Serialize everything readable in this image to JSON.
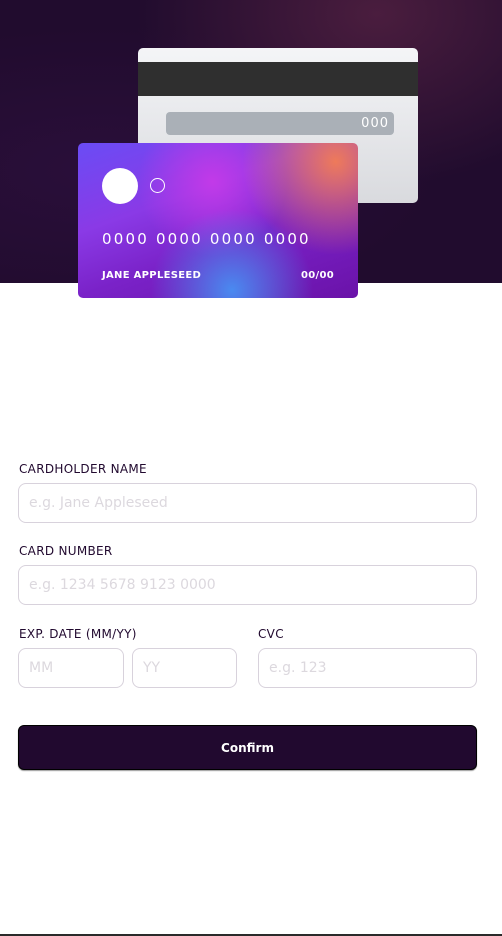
{
  "card": {
    "number": "0000 0000 0000 0000",
    "holder": "JANE APPLESEED",
    "expiry": "00/00",
    "cvc": "000"
  },
  "form": {
    "cardholder_label": "CARDHOLDER NAME",
    "cardholder_placeholder": "e.g. Jane Appleseed",
    "number_label": "CARD NUMBER",
    "number_placeholder": "e.g. 1234 5678 9123 0000",
    "exp_label": "EXP. DATE (MM/YY)",
    "mm_placeholder": "MM",
    "yy_placeholder": "YY",
    "cvc_label": "CVC",
    "cvc_placeholder": "e.g. 123",
    "confirm_label": "Confirm"
  },
  "colors": {
    "dark_violet": "#21092f",
    "input_border": "#d8d2dc",
    "placeholder": "#dcd8de"
  }
}
